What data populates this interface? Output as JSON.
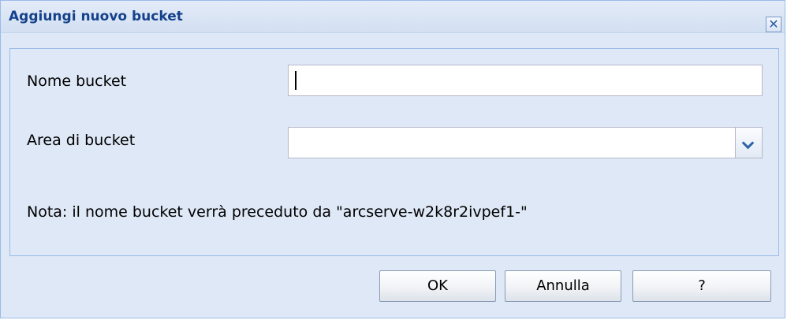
{
  "dialog": {
    "title": "Aggiungi nuovo bucket",
    "close_glyph": "✕"
  },
  "form": {
    "bucket_name_label": "Nome bucket",
    "bucket_name_value": "",
    "bucket_region_label": "Area di bucket",
    "bucket_region_value": "",
    "note": "Nota: il nome bucket verrà preceduto da \"arcserve-w2k8r2ivpef1-\""
  },
  "buttons": {
    "ok": "OK",
    "cancel": "Annulla",
    "help": "?"
  },
  "colors": {
    "title_text": "#15428b",
    "panel_bg": "#dfe8f6",
    "border": "#99bbe8"
  }
}
